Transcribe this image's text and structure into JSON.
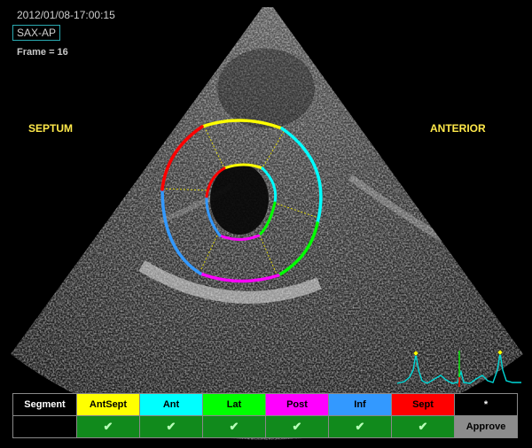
{
  "timestamp": "2012/01/08-17:00:15",
  "view": "SAX-AP",
  "frame": "Frame = 16",
  "orientation": {
    "left": "SEPTUM",
    "right": "ANTERIOR"
  },
  "segment_bar": {
    "header": "Segment",
    "segments": [
      {
        "label": "AntSept",
        "color": "#ffff00",
        "approved": "✔"
      },
      {
        "label": "Ant",
        "color": "#00ffff",
        "approved": "✔"
      },
      {
        "label": "Lat",
        "color": "#00ff00",
        "approved": "✔"
      },
      {
        "label": "Post",
        "color": "#ff00ff",
        "approved": "✔"
      },
      {
        "label": "Inf",
        "color": "#3399ff",
        "approved": "✔"
      },
      {
        "label": "Sept",
        "color": "#ff0000",
        "approved": "✔"
      }
    ],
    "star": "*",
    "approve_label": "Approve"
  },
  "ecg_color": "#00d8d8"
}
